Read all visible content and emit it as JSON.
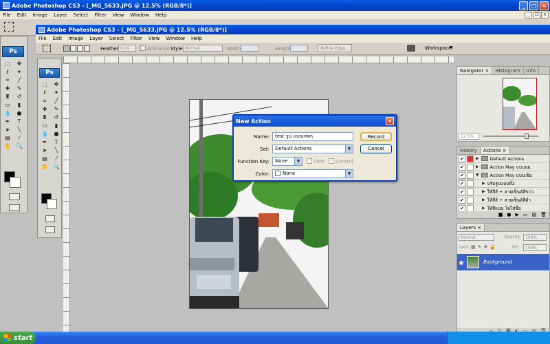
{
  "outer_window": {
    "title": "Adobe Photoshop CS3 - [_MG_5633.JPG @ 12.5% (RGB/8*)]"
  },
  "outer_menu": [
    "File",
    "Edit",
    "Image",
    "Layer",
    "Select",
    "Filter",
    "View",
    "Window",
    "Help"
  ],
  "inner_window": {
    "title": "Adobe Photoshop CS3 - [_MG_5633.JPG @ 12.5% (RGB/8*)]"
  },
  "inner_menu": [
    "File",
    "Edit",
    "Image",
    "Layer",
    "Select",
    "Filter",
    "View",
    "Window",
    "Help"
  ],
  "options": {
    "feather_label": "Feather:",
    "feather_value": "0 px",
    "antialias_label": "Anti-alias",
    "style_label": "Style:",
    "style_value": "Normal",
    "width_label": "Width:",
    "height_label": "Height:",
    "refine_label": "Refine Edge...",
    "workspace_label": "Workspace"
  },
  "ps_logo": "Ps",
  "navigator": {
    "tabs": [
      "Navigator",
      "Histogram",
      "Info"
    ],
    "zoom": "12.5%"
  },
  "actions": {
    "tabs": [
      "History",
      "Actions"
    ],
    "rows": [
      {
        "label": "Default Actions",
        "type": "set"
      },
      {
        "label": "Action May แบบนม",
        "type": "set"
      },
      {
        "label": "Action May แบบเข้ม",
        "type": "set"
      },
      {
        "label": "ปรับรูปแบบที่2",
        "type": "action"
      },
      {
        "label": "ให้สีส์ + ลายเซ็นต์สีขาว",
        "type": "action"
      },
      {
        "label": "ให้สีส์ + ลายเซ็นต์สีดำ",
        "type": "action"
      },
      {
        "label": "ให้สีแบบ ไม่ใส่ชื่อ",
        "type": "action"
      }
    ]
  },
  "layers": {
    "tabs": [
      "Layers"
    ],
    "blend": "Normal",
    "opacity_label": "Opacity:",
    "opacity_value": "100%",
    "lock_label": "Lock:",
    "fill_label": "Fill:",
    "fill_value": "100%",
    "layer_name": "Background"
  },
  "dialog": {
    "title": "New Action",
    "name_label": "Name:",
    "name_value": "test รูป แบบเทพๆ",
    "set_label": "Set:",
    "set_value": "Default Actions",
    "fkey_label": "Function Key:",
    "fkey_value": "None",
    "shift_label": "Shift",
    "control_label": "Control",
    "color_label": "Color:",
    "color_value": "None",
    "record_label": "Record",
    "cancel_label": "Cancel"
  },
  "taskbar": {
    "start_label": "start"
  },
  "colors": {
    "xp_blue": "#0447d0",
    "panel_bg": "#e9e7e2",
    "selected_layer": "#3a63c8"
  }
}
